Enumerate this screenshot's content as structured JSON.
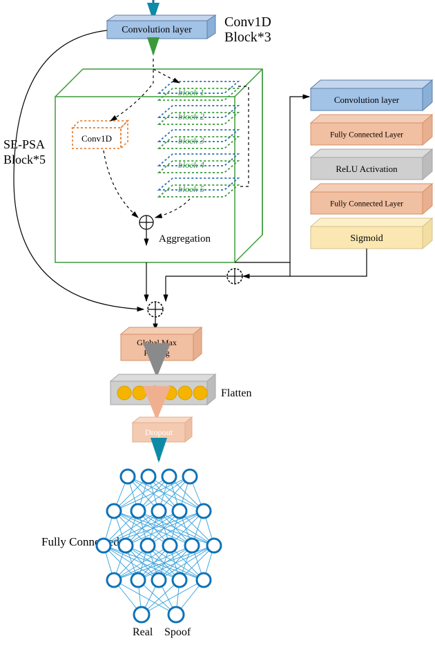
{
  "title_right_line1": "Conv1D",
  "title_right_line2": "Block*3",
  "left_label_line1": "SE-PSA",
  "left_label_line2": "Block*5",
  "conv_layer": "Convolution layer",
  "conv1d_inner": "Conv1D",
  "block_labels": [
    "block 1",
    "block 2",
    "block 3",
    "block 4",
    "block 5"
  ],
  "aggregation": "Aggregation",
  "right_stack": {
    "conv": "Convolution layer",
    "fc1": "Fully Connected Layer",
    "relu": "ReLU Activation",
    "fc2": "Fully Connected Layer",
    "sigmoid": "Sigmoid"
  },
  "global_max_pool": "Global Max\nPooling",
  "flatten": "Flatten",
  "dropout": "Dropout",
  "fully_connected": "Fully Connected",
  "out_real": "Real",
  "out_spoof": "Spoof"
}
